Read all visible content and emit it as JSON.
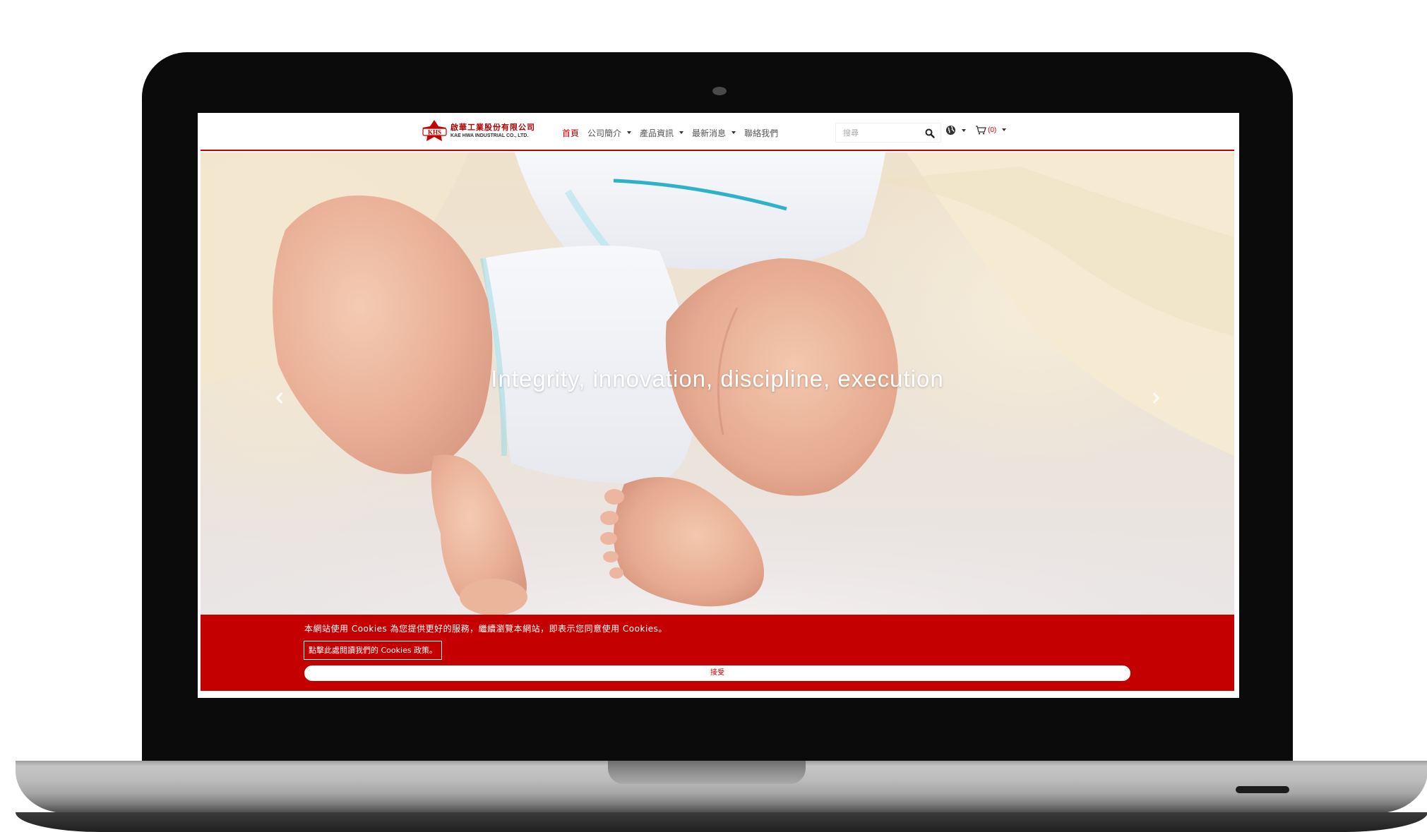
{
  "header": {
    "logo": {
      "mark": "KHS",
      "name_cn": "啟華工業股份有限公司",
      "name_en": "KAE HWA INDUSTRIAL CO., LTD."
    },
    "nav": [
      {
        "label": "首頁",
        "active": true,
        "dropdown": false
      },
      {
        "label": "公司簡介",
        "active": false,
        "dropdown": true
      },
      {
        "label": "產品資訊",
        "active": false,
        "dropdown": true
      },
      {
        "label": "最新消息",
        "active": false,
        "dropdown": true
      },
      {
        "label": "聯絡我們",
        "active": false,
        "dropdown": false
      }
    ],
    "search": {
      "placeholder": "搜尋",
      "icon": "search-icon"
    },
    "language_icon": "globe-icon",
    "cart": {
      "icon": "cart-icon",
      "count": "(0)"
    }
  },
  "hero": {
    "slogan": "Integrity, innovation, discipline, execution",
    "prev_icon": "chevron-left-icon",
    "next_icon": "chevron-right-icon"
  },
  "cookie_notice": {
    "message": "本網站使用 Cookies 為您提供更好的服務，繼續瀏覽本網站，即表示您同意使用 Cookies。",
    "policy_link": "點擊此處閱讀我們的 Cookies 政策。",
    "accept_label": "接受"
  },
  "colors": {
    "brand_red": "#c40000",
    "laptop_bezel": "#0b0b0b",
    "laptop_body": "#bdbdbd"
  }
}
